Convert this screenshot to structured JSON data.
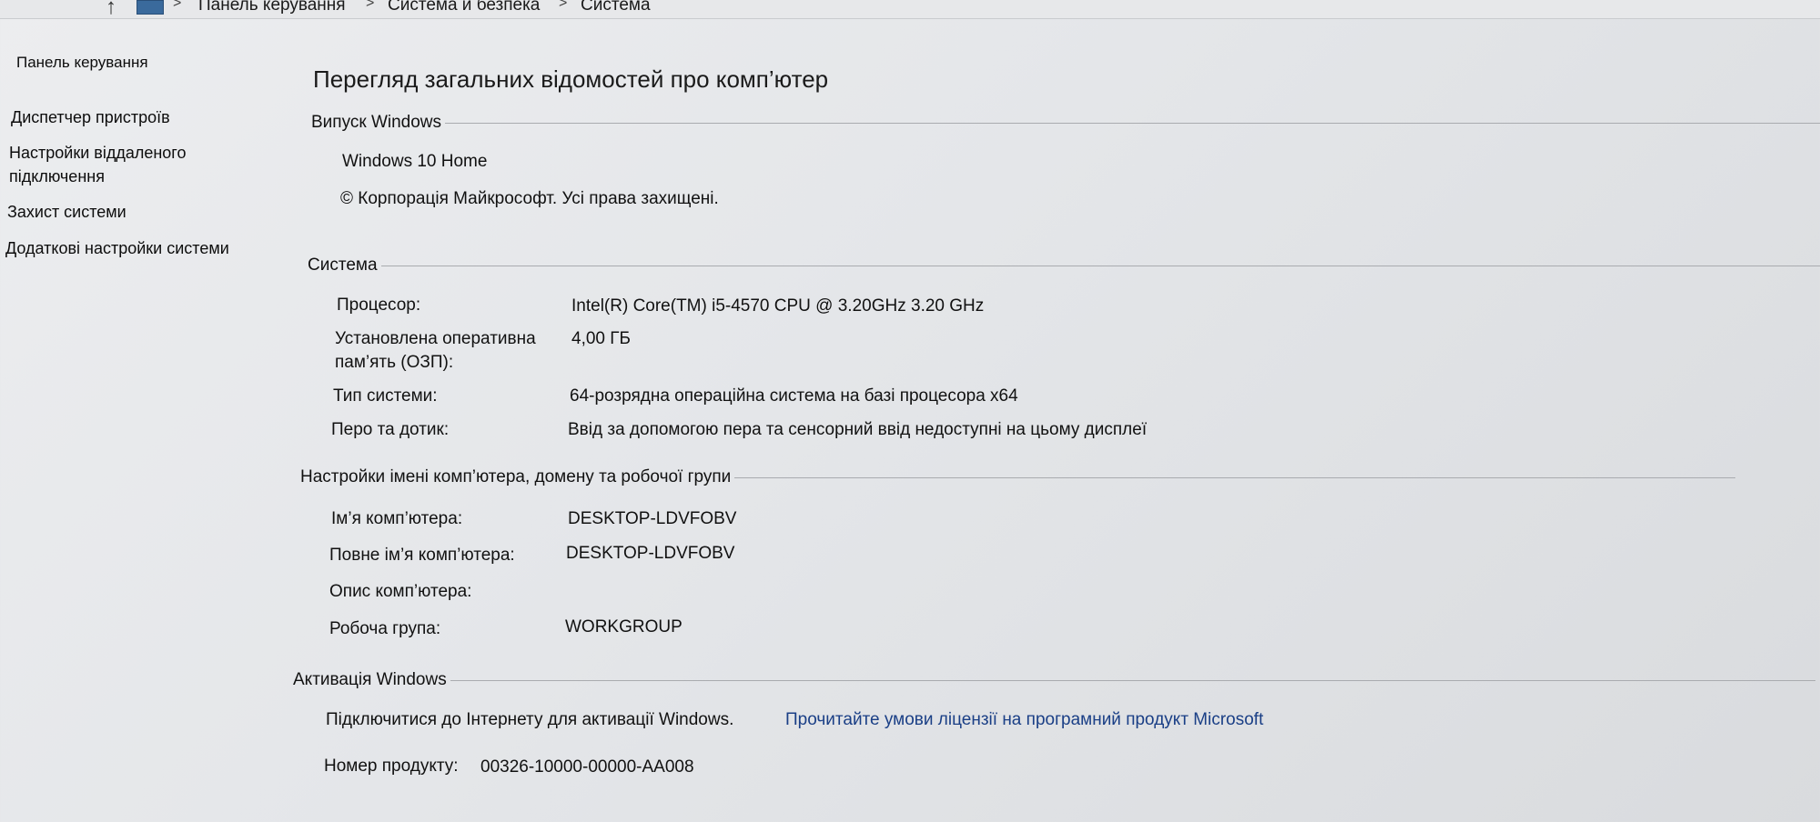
{
  "breadcrumb": {
    "items": [
      "Панель керування",
      "Система й безпека",
      "Система"
    ],
    "separator": ">"
  },
  "sidebar": {
    "home": "Панель керування",
    "links": [
      {
        "label": "Диспетчер пристроїв"
      },
      {
        "label_line1": "Настройки віддаленого",
        "label_line2": "підключення"
      },
      {
        "label": "Захист системи"
      },
      {
        "label": "Додаткові настройки системи"
      }
    ]
  },
  "main": {
    "title": "Перегляд загальних відомостей про комп’ютер",
    "edition": {
      "heading": "Випуск Windows",
      "name": "Windows 10 Home",
      "copyright": "© Корпорація Майкрософт. Усі права захищені."
    },
    "system": {
      "heading": "Система",
      "processor_label": "Процесор:",
      "processor_value": "Intel(R) Core(TM) i5-4570 CPU @ 3.20GHz   3.20 GHz",
      "ram_label_line1": "Установлена оперативна",
      "ram_label_line2": "пам’ять (ОЗП):",
      "ram_value": "4,00 ГБ",
      "type_label": "Тип системи:",
      "type_value": "64-розрядна операційна система на базі процесора x64",
      "pen_label": "Перо та дотик:",
      "pen_value": "Ввід за допомогою пера та сенсорний ввід недоступні на цьому дисплеї"
    },
    "computer_name": {
      "heading": "Настройки імені комп’ютера, домену та робочої групи",
      "name_label": "Ім’я комп’ютера:",
      "name_value": "DESKTOP-LDVFOBV",
      "full_name_label": "Повне ім’я комп’ютера:",
      "full_name_value": "DESKTOP-LDVFOBV",
      "description_label": "Опис комп’ютера:",
      "workgroup_label": "Робоча група:",
      "workgroup_value": "WORKGROUP"
    },
    "activation": {
      "heading": "Активація Windows",
      "status_text": "Підключитися до Інтернету для активації Windows.",
      "license_link": "Прочитайте умови ліцензії на програмний продукт Microsoft",
      "product_id_label": "Номер продукту:",
      "product_id_value": "00326-10000-00000-AA008"
    }
  },
  "colors": {
    "link": "#1a3f86",
    "text": "#121212",
    "rule": "#a9abaf"
  }
}
